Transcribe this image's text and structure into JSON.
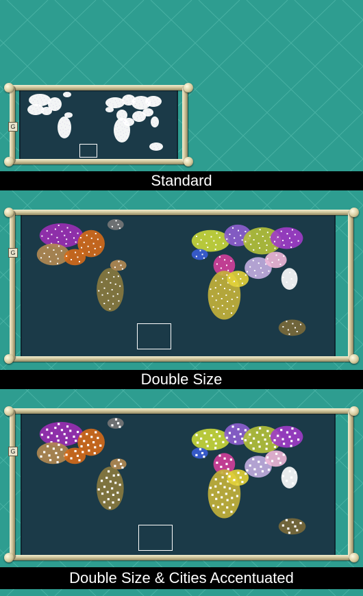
{
  "panels": [
    {
      "id": "standard",
      "caption": "Standard",
      "map_button": "G"
    },
    {
      "id": "double",
      "caption": "Double Size",
      "map_button": "G"
    },
    {
      "id": "double_accent",
      "caption": "Double Size & Cities Accentuated",
      "map_button": "G"
    }
  ],
  "colors": {
    "ocean_tile": "#2e9d90",
    "map_water": "#1b3a48",
    "caption_bg": "#000000",
    "caption_text": "#ffffff",
    "frame": "#d8cfa6",
    "viewport_marker": "#ffffff"
  },
  "icons": [
    "map-frame-knob",
    "viewport-rectangle",
    "city-dot"
  ]
}
